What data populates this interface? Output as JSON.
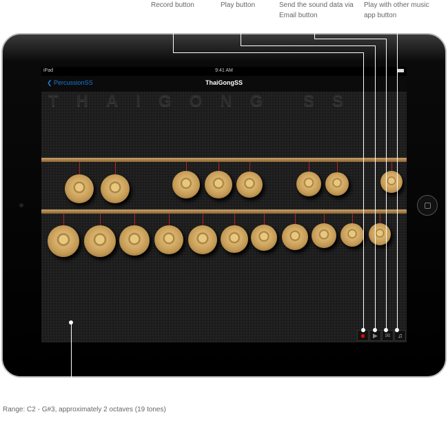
{
  "annotations": {
    "record": "Record button",
    "play": "Play button",
    "email": "Send the sound data via Email button",
    "music": "Play with other music app button",
    "range": "Range: C2 - G#3, approximately 2 octaves (19 tones)"
  },
  "status": {
    "device": "iPad",
    "time": "9:41 AM"
  },
  "nav": {
    "back": "PercussionSS",
    "title": "ThaiGongSS"
  },
  "logo": "THAIGONG SS",
  "controls": {
    "record_color": "#ff0000",
    "icons": [
      "record-icon",
      "play-icon",
      "mail-icon",
      "music-note-icon"
    ]
  },
  "gongs": {
    "top_row": 8,
    "bottom_row": 11
  }
}
